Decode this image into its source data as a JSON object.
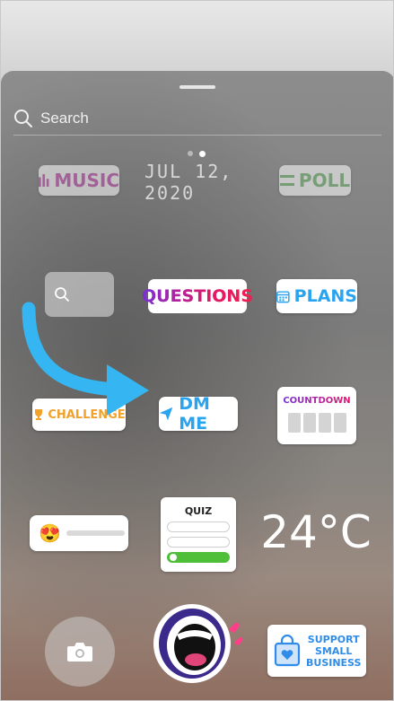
{
  "search": {
    "label": "Search"
  },
  "pager": {
    "count": 2,
    "active_index": 1
  },
  "stickers": {
    "music": "MUSIC",
    "date": "JUL 12, 2020",
    "poll": "POLL",
    "questions": "QUESTIONS",
    "plans": "PLANS",
    "challenge": "CHALLENGE",
    "dm_me": "DM ME",
    "countdown": "COUNTDOWN",
    "slider_emoji": "😍",
    "quiz": "QUIZ",
    "temperature": "24°C",
    "support_line1": "SUPPORT",
    "support_line2": "SMALL",
    "support_line3": "BUSINESS"
  },
  "colors": {
    "accent_blue": "#2aa4ef",
    "questions_gradient_start": "#7a2fd8",
    "questions_gradient_end": "#f0204f",
    "challenge_orange": "#f2a12a",
    "poll_green": "#6cb26a",
    "music_pink": "#c44fb0"
  },
  "icons": {
    "search": "search-icon",
    "camera": "camera-icon",
    "arrow": "curved-arrow-icon"
  }
}
